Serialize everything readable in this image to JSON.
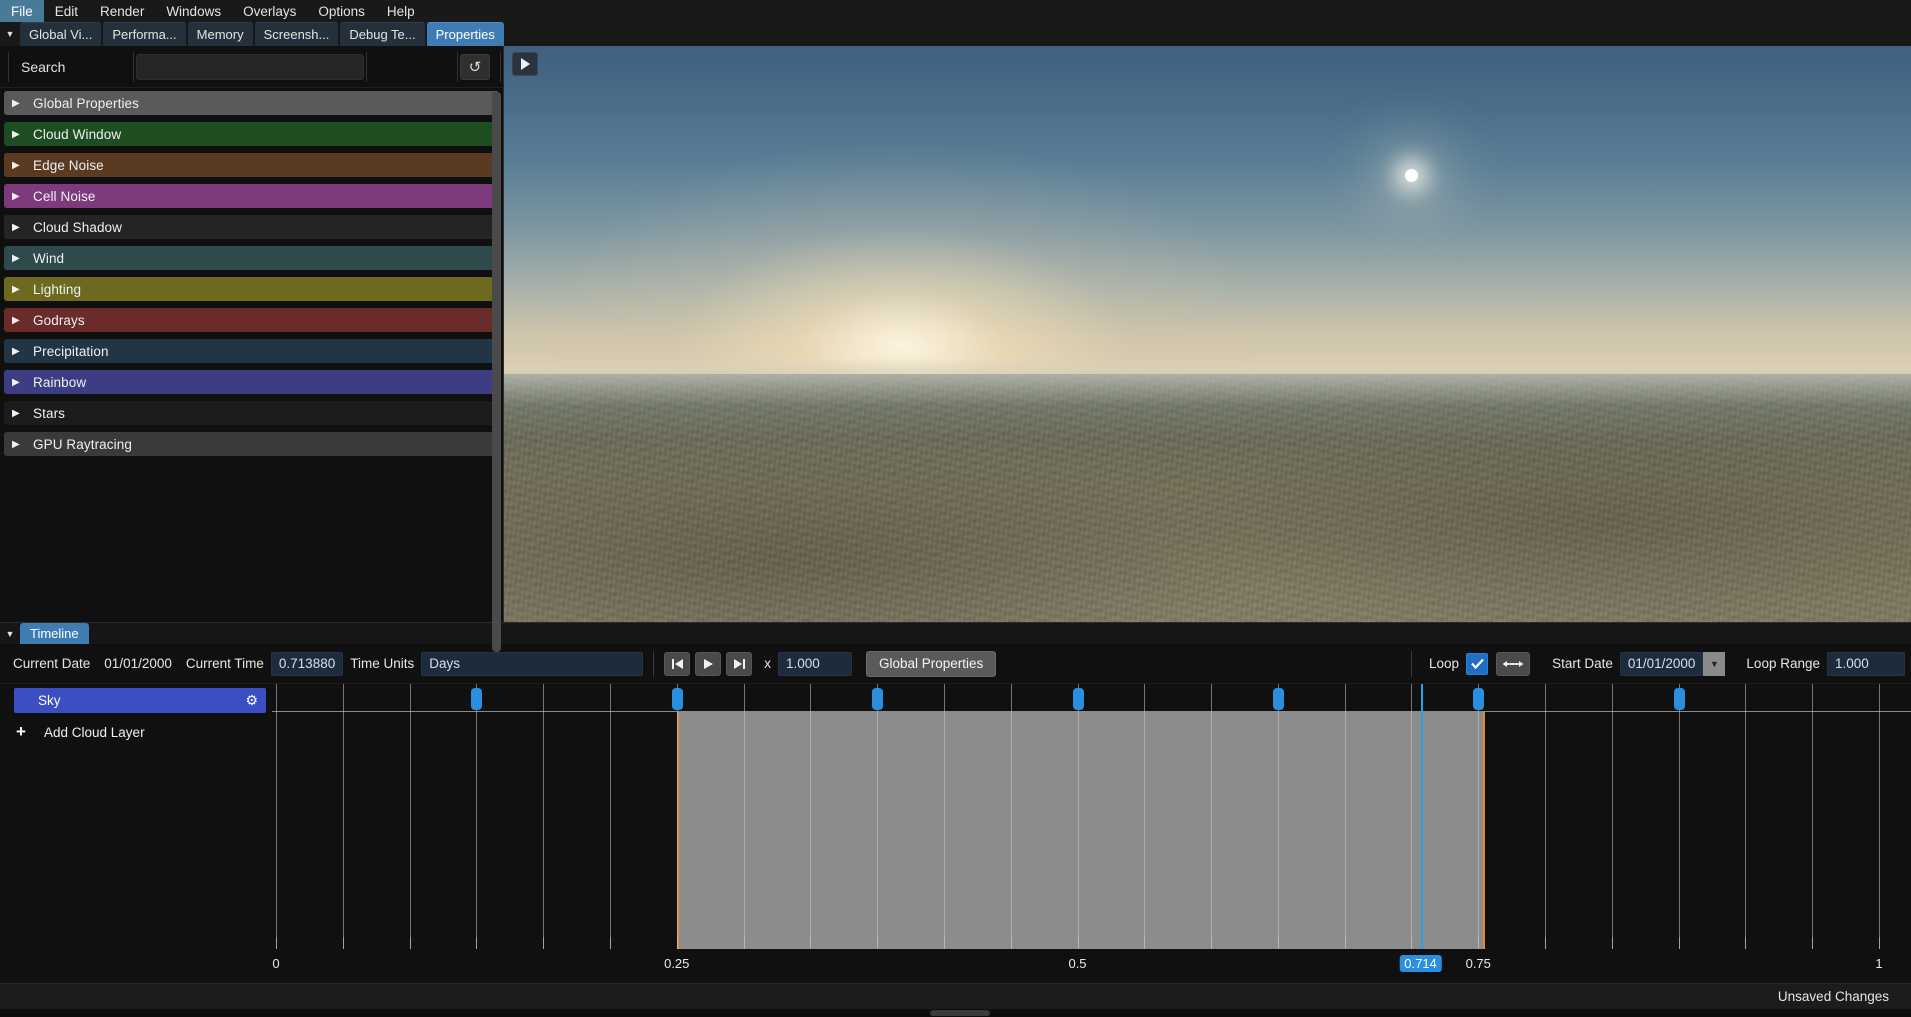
{
  "menubar": {
    "items": [
      {
        "label": "File",
        "active": true
      },
      {
        "label": "Edit",
        "active": false
      },
      {
        "label": "Render",
        "active": false
      },
      {
        "label": "Windows",
        "active": false
      },
      {
        "label": "Overlays",
        "active": false
      },
      {
        "label": "Options",
        "active": false
      },
      {
        "label": "Help",
        "active": false
      }
    ]
  },
  "tabbar": {
    "overflow_icon": "chevron-down-icon",
    "tabs": [
      {
        "label": "Global Vi...",
        "active": false
      },
      {
        "label": "Performa...",
        "active": false
      },
      {
        "label": "Memory",
        "active": false
      },
      {
        "label": "Screensh...",
        "active": false
      },
      {
        "label": "Debug Te...",
        "active": false
      },
      {
        "label": "Properties",
        "active": true
      }
    ]
  },
  "properties_panel": {
    "search_label": "Search",
    "search_value": "",
    "search_placeholder": "",
    "reset_icon": "reset-icon",
    "rows": [
      {
        "label": "Global Properties",
        "color": "#5a5a5a"
      },
      {
        "label": "Cloud Window",
        "color": "#1f4d22"
      },
      {
        "label": "Edge Noise",
        "color": "#5a3b22"
      },
      {
        "label": "Cell Noise",
        "color": "#7d3a7d"
      },
      {
        "label": "Cloud Shadow",
        "color": "#242424"
      },
      {
        "label": "Wind",
        "color": "#2e4a4d"
      },
      {
        "label": "Lighting",
        "color": "#6d6a1f"
      },
      {
        "label": "Godrays",
        "color": "#6b2b2b"
      },
      {
        "label": "Precipitation",
        "color": "#213545"
      },
      {
        "label": "Rainbow",
        "color": "#3d3d84"
      },
      {
        "label": "Stars",
        "color": "#1c1c1c"
      },
      {
        "label": "GPU Raytracing",
        "color": "#3a3a3a"
      }
    ]
  },
  "viewport": {
    "play_icon": "play-icon",
    "scene_description": "Dawn desert landscape with low sun near horizon"
  },
  "timeline": {
    "panel_tab": "Timeline",
    "overflow_icon": "chevron-down-icon",
    "current_date_label": "Current Date",
    "current_date_value": "01/01/2000",
    "current_time_label": "Current Time",
    "current_time_value": "0.713880",
    "time_units_label": "Time Units",
    "time_units_value": "Days",
    "transport": {
      "skip_start_icon": "skip-to-start-icon",
      "play_icon": "play-icon",
      "skip_end_icon": "skip-to-end-icon"
    },
    "speed_label": "x",
    "speed_value": "1.000",
    "global_properties_button": "Global Properties",
    "loop_label": "Loop",
    "loop_checked": true,
    "loop_check_icon": "check-icon",
    "fit_icon": "left-right-arrow-icon",
    "start_date_label": "Start Date",
    "start_date_value": "01/01/2000",
    "start_date_dropdown_icon": "chevron-down-icon",
    "loop_range_label": "Loop Range",
    "loop_range_value": "1.000",
    "layers": [
      {
        "name": "Sky",
        "color": "#3b4ec4",
        "gear_icon": "gear-icon"
      }
    ],
    "add_layer_label": "Add Cloud Layer",
    "add_layer_icon": "plus-icon",
    "ruler": {
      "min": 0,
      "max": 1,
      "tick_labels": [
        {
          "value": 0,
          "label": "0"
        },
        {
          "value": 0.25,
          "label": "0.25"
        },
        {
          "value": 0.5,
          "label": "0.5"
        },
        {
          "value": 0.75,
          "label": "0.75"
        },
        {
          "value": 1,
          "label": "1"
        }
      ],
      "minor_ticks": [
        0.0,
        0.0417,
        0.0833,
        0.125,
        0.1667,
        0.2083,
        0.25,
        0.2917,
        0.3333,
        0.375,
        0.4167,
        0.4583,
        0.5,
        0.5417,
        0.5833,
        0.625,
        0.6667,
        0.7083,
        0.75,
        0.7917,
        0.8333,
        0.875,
        0.9167,
        0.9583,
        1.0
      ]
    },
    "selection_range": {
      "start": 0.25,
      "end": 0.754
    },
    "keyframes": [
      0.125,
      0.25,
      0.375,
      0.5,
      0.625,
      0.75,
      0.875
    ],
    "playhead": {
      "value": 0.714,
      "label": "0.714"
    }
  },
  "statusbar": {
    "message": "Unsaved Changes"
  }
}
